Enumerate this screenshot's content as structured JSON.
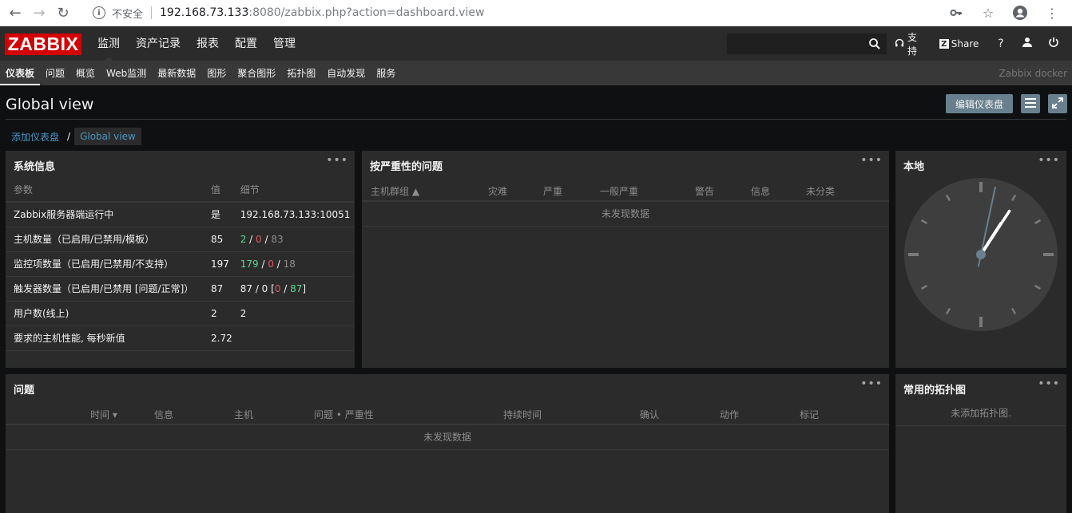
{
  "browser": {
    "insecure_label": "不安全",
    "url_host": "192.168.73.133",
    "url_rest": ":8080/zabbix.php?action=dashboard.view"
  },
  "brand": {
    "logo": "ZABBIX"
  },
  "main_menu": [
    "监测",
    "资产记录",
    "报表",
    "配置",
    "管理"
  ],
  "top_right": {
    "support": "支持",
    "share": "Share",
    "help": "?"
  },
  "sub_menu": [
    "仪表板",
    "问题",
    "概览",
    "Web监测",
    "最新数据",
    "图形",
    "聚合图形",
    "拓扑图",
    "自动发现",
    "服务"
  ],
  "server_name": "Zabbix docker",
  "page": {
    "title": "Global view",
    "edit_button": "编辑仪表盘"
  },
  "breadcrumb": {
    "parent": "添加仪表盘",
    "separator": "/",
    "current": "Global view"
  },
  "system_info": {
    "title": "系统信息",
    "headers": [
      "参数",
      "值",
      "细节"
    ],
    "rows": [
      {
        "param": "Zabbix服务器端运行中",
        "value": "是",
        "detail": "192.168.73.133:10051"
      },
      {
        "param": "主机数量（已启用/已禁用/模板）",
        "value": "85",
        "d1": "2",
        "d2": "0",
        "d3": "83"
      },
      {
        "param": "监控项数量（已启用/已禁用/不支持）",
        "value": "197",
        "d1": "179",
        "d2": "0",
        "d3": "18"
      },
      {
        "param": "触发器数量（已启用/已禁用 [问题/正常]）",
        "value": "87",
        "d1": "87",
        "d2": "0",
        "d3": "0",
        "d4": "87"
      },
      {
        "param": "用户数(线上)",
        "value": "2",
        "detail": "2"
      },
      {
        "param": "要求的主机性能, 每秒新值",
        "value": "2.72",
        "detail": ""
      }
    ]
  },
  "severity_problems": {
    "title": "按严重性的问题",
    "headers": [
      "主机群组 ▲",
      "灾难",
      "严重",
      "一般严重",
      "警告",
      "信息",
      "未分类"
    ],
    "empty": "未发现数据"
  },
  "clock": {
    "title": "本地",
    "hour": 1,
    "minute": 5,
    "second": 32
  },
  "problems": {
    "title": "问题",
    "headers": [
      "时间 ▾",
      "信息",
      "主机",
      "问题 • 严重性",
      "持续时间",
      "确认",
      "动作",
      "标记"
    ],
    "empty": "未发现数据"
  },
  "favorite_maps": {
    "title": "常用的拓扑图",
    "empty": "未添加拓扑图."
  },
  "colors": {
    "brand": "#d40000",
    "ok": "#59db8f",
    "problem": "#e45959",
    "link": "#4796c4"
  }
}
